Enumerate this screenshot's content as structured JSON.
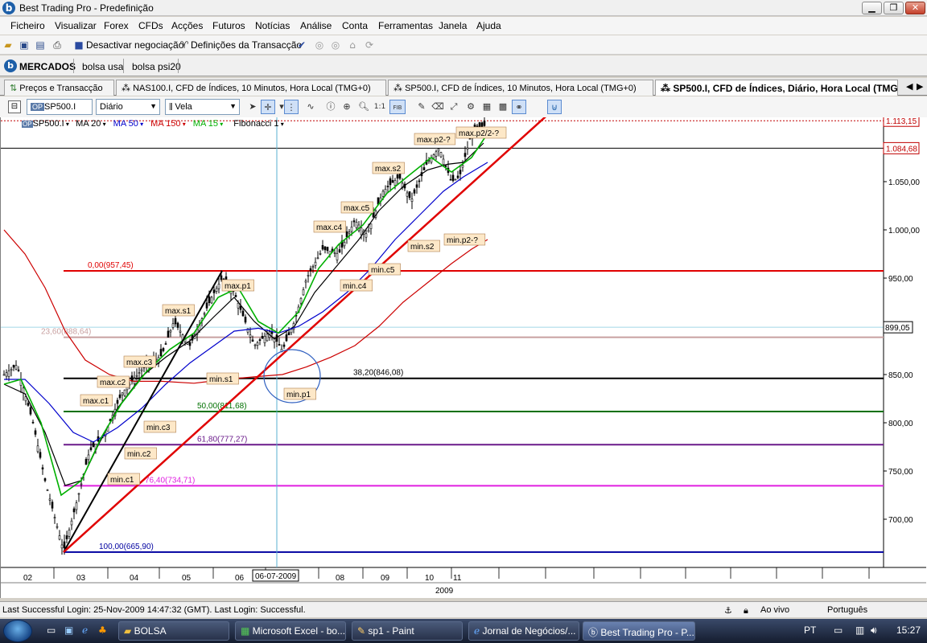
{
  "window": {
    "title": "Best Trading Pro - Predefinição",
    "logo_letter": "b"
  },
  "menu": [
    "Ficheiro",
    "Visualizar",
    "Forex",
    "CFDs",
    "Acções",
    "Futuros",
    "Notícias",
    "Análise",
    "Conta",
    "Ferramentas",
    "Janela",
    "Ajuda"
  ],
  "toolbar": {
    "deactivate": "Desactivar negociação",
    "transaction_settings": "Definições da Transacção"
  },
  "workspace_tabs": [
    "MERCADOS",
    "bolsa usa",
    "bolsa psi20"
  ],
  "doc_tabs": [
    "Preços e Transacção",
    "NAS100.I, CFD de Índices, 10 Minutos, Hora Local (TMG+0)",
    "SP500.I, CFD de Índices, 10 Minutos, Hora Local (TMG+0)",
    "SP500.I, CFD de Índices, Diário, Hora Local (TMG+0)"
  ],
  "chart_tools": {
    "symbol": "SP500.I",
    "period": "Diário",
    "style": "Vela",
    "fib_button": "FIB"
  },
  "indicators": [
    "SP500.I",
    "MA 20",
    "MA 50",
    "MA 150",
    "MA 15",
    "Fibonacci 1"
  ],
  "colors": {
    "ma20": "#000000",
    "ma50": "#0000cc",
    "ma150": "#cc0000",
    "ma15": "#00b000",
    "fib0": "#e00000",
    "fib236": "#c8a0a0",
    "fib382": "#000000",
    "fib50": "#007000",
    "fib618": "#6a1a8a",
    "fib764": "#e020e0",
    "fib100": "#0000a0",
    "trend": "#e00000"
  },
  "chart_data": {
    "type": "candlestick",
    "symbol": "SP500.I",
    "ylim": [
      662,
      1150
    ],
    "y_ticks": [
      "700,00",
      "750,00",
      "800,00",
      "850,00",
      "900,00",
      "950,00",
      "1.000,00",
      "1.050,00"
    ],
    "x_ticks": [
      "02",
      "03",
      "04",
      "05",
      "06",
      "08",
      "09",
      "10",
      "11"
    ],
    "x_year": "2009",
    "crosshair_date": "06-07-2009",
    "crosshair_price": "899,05",
    "price_tags": [
      "1.113,15",
      "1.084,68"
    ],
    "fibonacci": [
      {
        "label": "0,00(957,45)",
        "value": 957.45
      },
      {
        "label": "23,60(888,64)",
        "value": 888.64
      },
      {
        "label": "38,20(846,08)",
        "value": 846.08
      },
      {
        "label": "50,00(811,68)",
        "value": 811.68
      },
      {
        "label": "61,80(777,27)",
        "value": 777.27
      },
      {
        "label": "76,40(734,71)",
        "value": 734.71
      },
      {
        "label": "100,00(665,90)",
        "value": 665.9
      }
    ],
    "annotations": [
      {
        "label": "max.p1",
        "value": 957
      },
      {
        "label": "min.p1",
        "value": 869
      },
      {
        "label": "max.s1",
        "value": 930
      },
      {
        "label": "min.s1",
        "value": 879
      },
      {
        "label": "max.c1",
        "value": 844
      },
      {
        "label": "max.c2",
        "value": 860
      },
      {
        "label": "max.c3",
        "value": 880
      },
      {
        "label": "min.c1",
        "value": 765
      },
      {
        "label": "min.c2",
        "value": 790
      },
      {
        "label": "min.c3",
        "value": 818
      },
      {
        "label": "max.c4",
        "value": 1010
      },
      {
        "label": "min.c4",
        "value": 958
      },
      {
        "label": "max.c5",
        "value": 1045
      },
      {
        "label": "min.c5",
        "value": 992
      },
      {
        "label": "max.s2",
        "value": 1080
      },
      {
        "label": "min.s2",
        "value": 1020
      },
      {
        "label": "max.p2-?",
        "value": 1100
      },
      {
        "label": "min.p2-?",
        "value": 1030
      },
      {
        "label": "max.p2/2-?",
        "value": 1115
      }
    ]
  },
  "status": {
    "login": "Last Successful Login: 25-Nov-2009 14:47:32 (GMT). Last Login: Successful.",
    "live": "Ao vivo",
    "language": "Português"
  },
  "taskbar": {
    "items": [
      "BOLSA",
      "Microsoft Excel - bo...",
      "sp1 - Paint",
      "Jornal de Negócios/...",
      "Best Trading Pro - P..."
    ],
    "lang": "PT",
    "clock": "15:27"
  }
}
